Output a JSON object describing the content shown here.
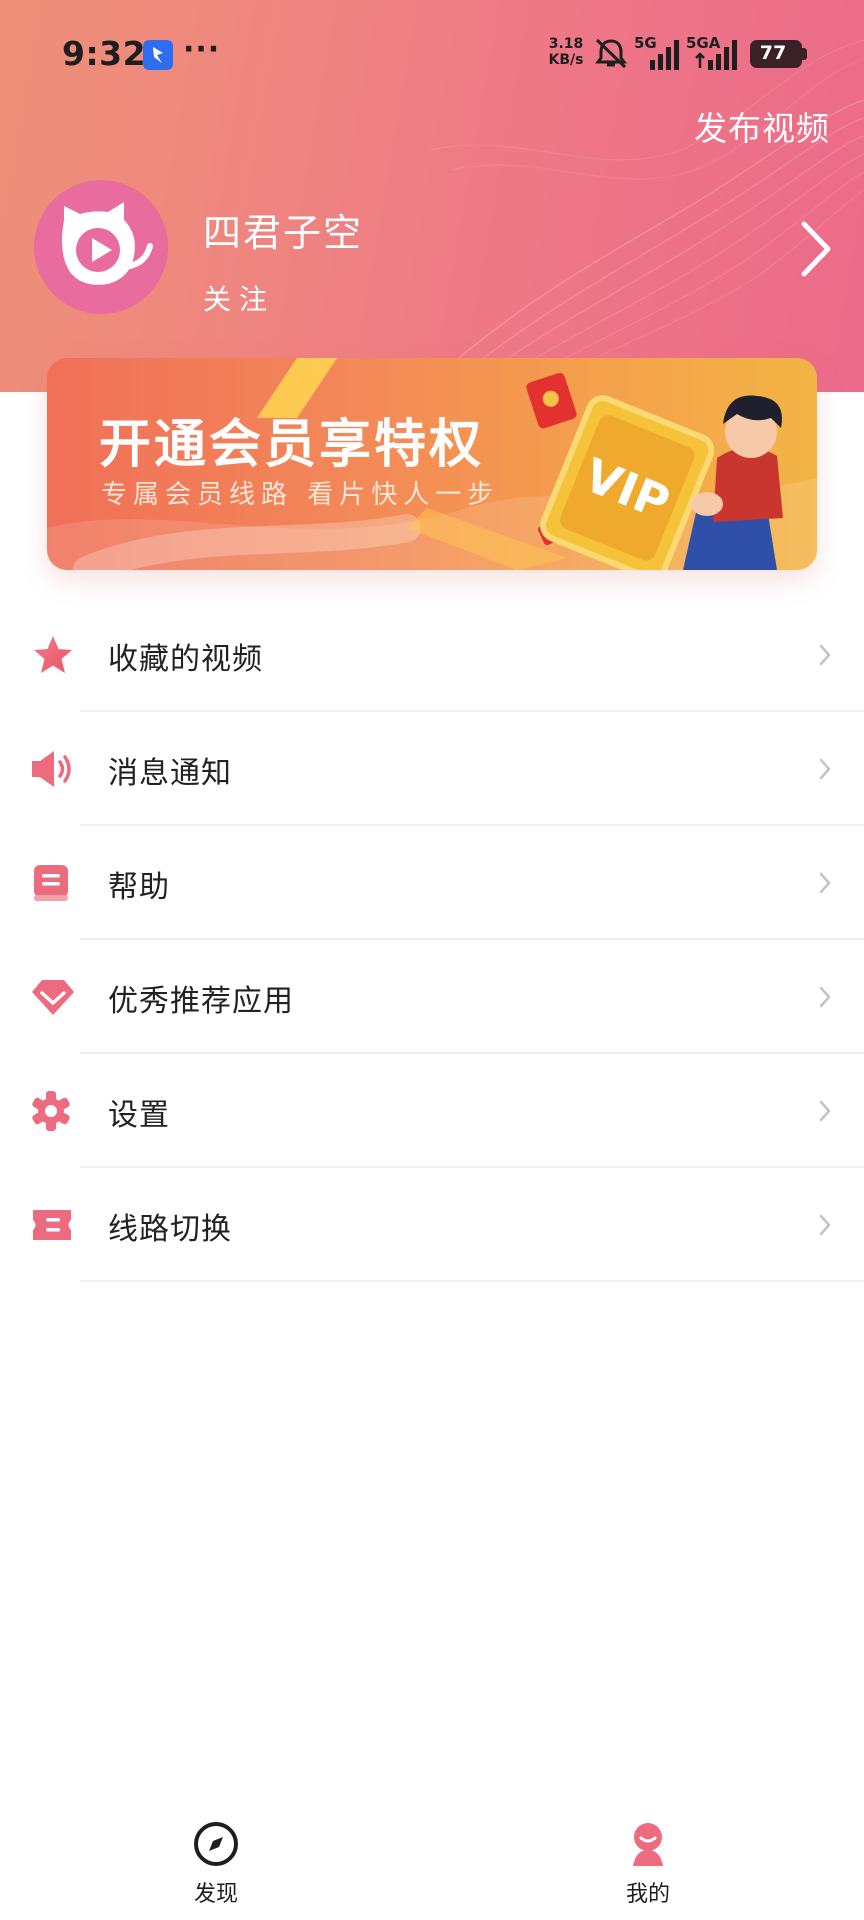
{
  "status_bar": {
    "time": "9:32",
    "more": "···",
    "speed_value": "3.18",
    "speed_unit": "KB/s",
    "network_1": "5G",
    "network_2": "5GA",
    "battery": "77"
  },
  "header": {
    "publish_label": "发布视频",
    "username": "四君子空",
    "follow_label": "关注"
  },
  "vip_banner": {
    "title": "开通会员享特权",
    "subtitle": "专属会员线路 看片快人一步",
    "badge": "VIP"
  },
  "menu": {
    "items": [
      {
        "label": "收藏的视频",
        "icon": "star-icon"
      },
      {
        "label": "消息通知",
        "icon": "speaker-icon"
      },
      {
        "label": "帮助",
        "icon": "help-book-icon"
      },
      {
        "label": "优秀推荐应用",
        "icon": "diamond-icon"
      },
      {
        "label": "设置",
        "icon": "gear-icon"
      },
      {
        "label": "线路切换",
        "icon": "ticket-icon"
      }
    ]
  },
  "bottom_nav": {
    "discover_label": "发现",
    "mine_label": "我的"
  },
  "colors": {
    "accent": "#ec6a8a",
    "header_start": "#ee9079",
    "icon_pink": "#ec6b7f"
  }
}
